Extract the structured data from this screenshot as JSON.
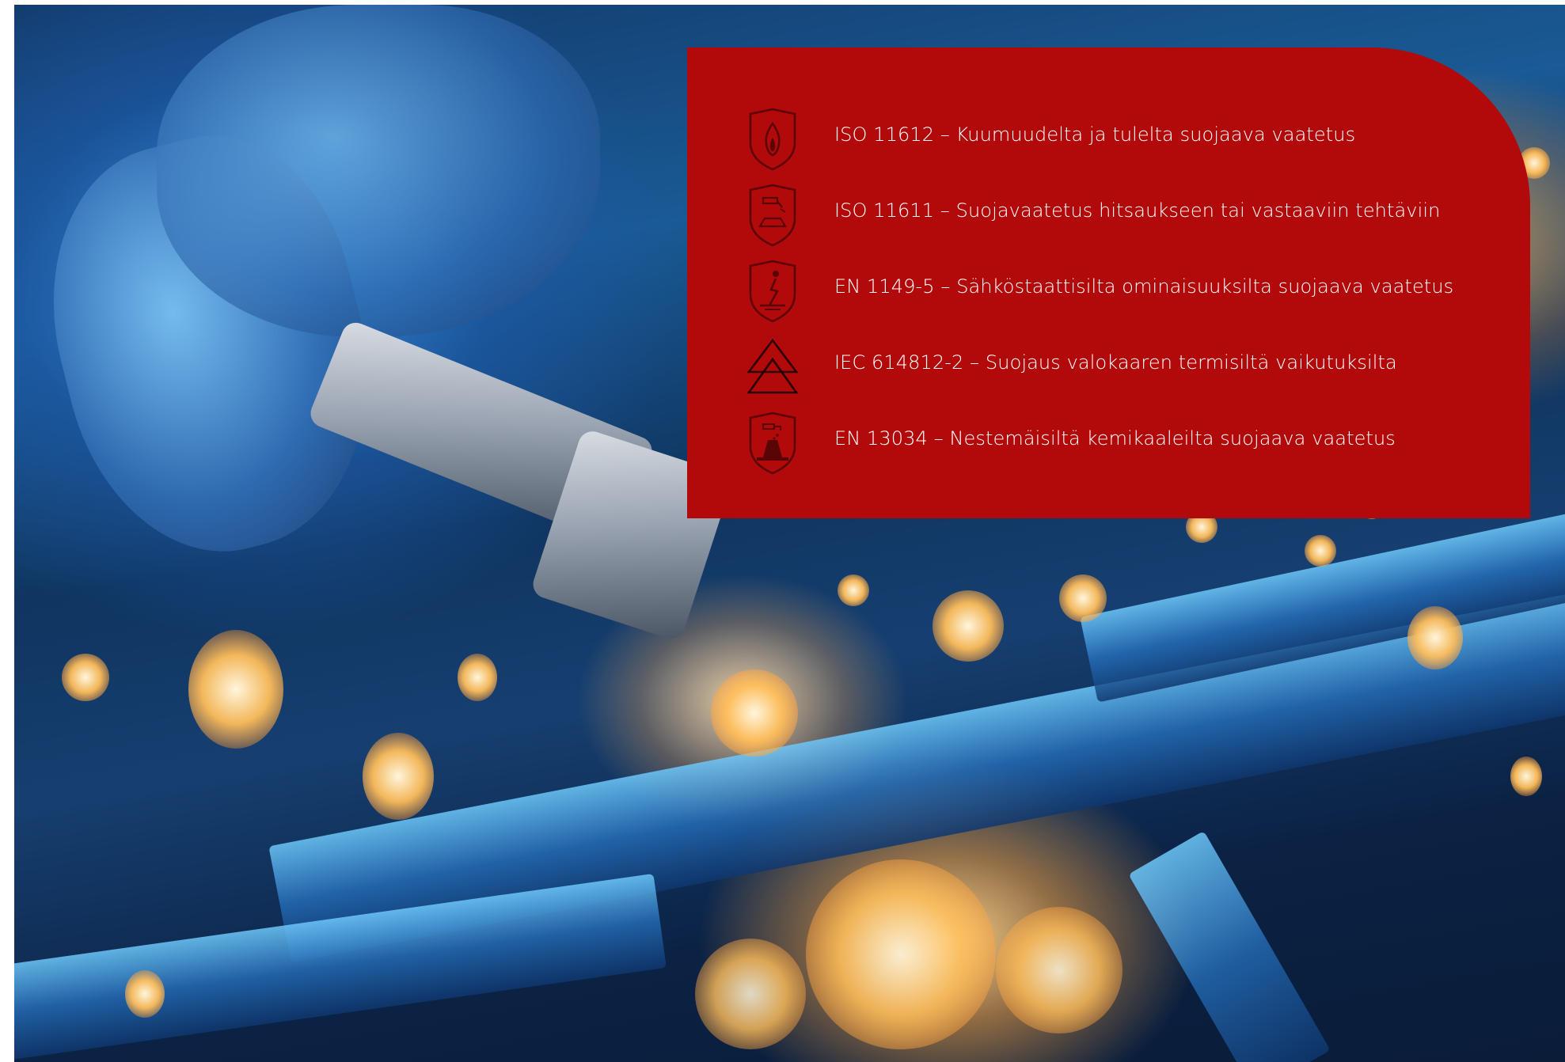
{
  "background": {
    "description_icon": "welding-grinder-sparks-photo"
  },
  "panel": {
    "color": "#b20a0a",
    "certifications": [
      {
        "icon": "flame-shield-icon",
        "label": "ISO 11612 – Kuumuudelta ja tulelta suojaava vaatetus"
      },
      {
        "icon": "welding-shield-icon",
        "label": "ISO 11611 – Suojavaatetus hitsaukseen tai vastaaviin tehtäviin"
      },
      {
        "icon": "electrostatic-shield-icon",
        "label": "EN 1149-5 – Sähköstaattisilta ominaisuuksilta suojaava vaatetus"
      },
      {
        "icon": "arc-flash-icon",
        "label": "IEC 614812-2 – Suojaus valokaaren termisiltä vaikutuksilta"
      },
      {
        "icon": "chemical-shield-icon",
        "label": "EN 13034 – Nestemäisiltä kemikaaleilta suojaava vaatetus"
      }
    ]
  }
}
